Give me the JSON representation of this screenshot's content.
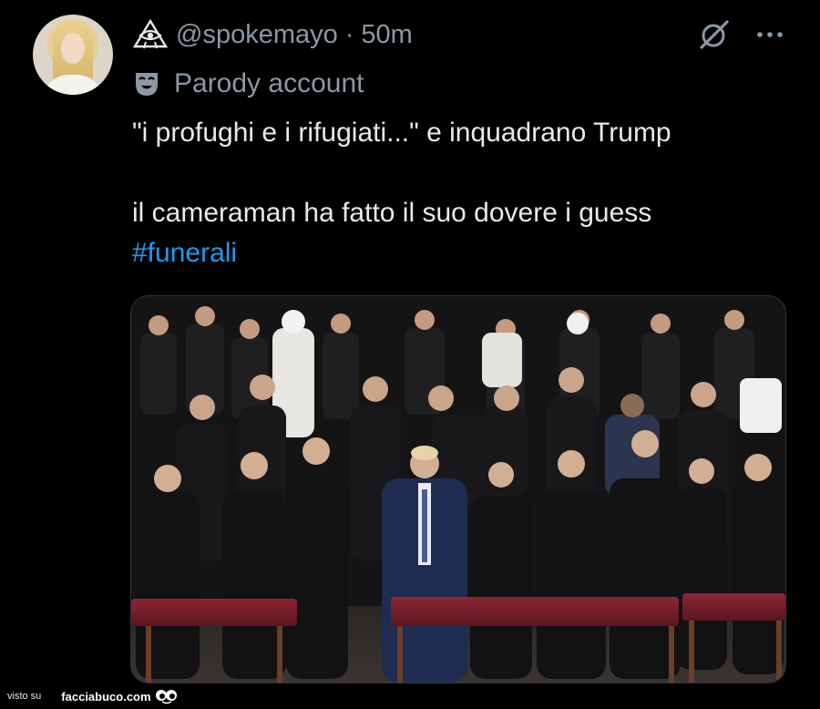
{
  "tweet": {
    "handle": "@spokemayo",
    "separator": "·",
    "time": "50m",
    "account_label": "Parody account",
    "text_line_1": "\"i profughi e i rifugiati...\" e inquadrano Trump",
    "text_line_2": "il cameraman ha fatto il suo dovere i guess",
    "hashtag": "#funerali"
  },
  "icons": {
    "eye": "eye-of-providence-icon",
    "grok": "grok-icon",
    "more": "more-options-icon",
    "mask": "theater-mask-icon",
    "avatar": "profile-avatar"
  },
  "footer": {
    "seen_on": "visto su",
    "site": "facciabuco.com"
  },
  "colors": {
    "background": "#000000",
    "text": "#e7e9ea",
    "secondary": "#8b98a5",
    "link": "#1d9bf0"
  }
}
